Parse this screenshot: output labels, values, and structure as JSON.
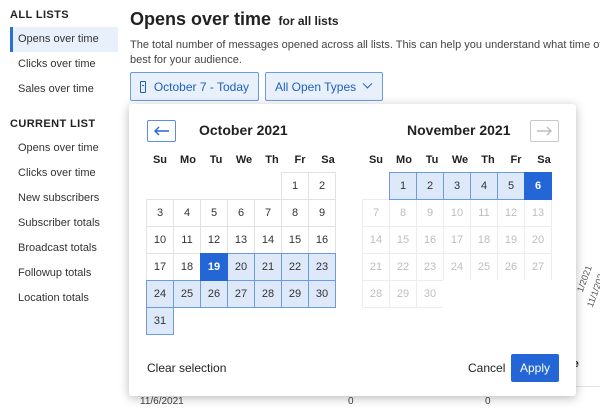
{
  "sidebar": {
    "all_lists_heading": "ALL LISTS",
    "all_lists_items": [
      {
        "label": "Opens over time"
      },
      {
        "label": "Clicks over time"
      },
      {
        "label": "Sales over time"
      }
    ],
    "current_list_heading": "CURRENT LIST",
    "current_list_items": [
      {
        "label": "Opens over time"
      },
      {
        "label": "Clicks over time"
      },
      {
        "label": "New subscribers"
      },
      {
        "label": "Subscriber totals"
      },
      {
        "label": "Broadcast totals"
      },
      {
        "label": "Followup totals"
      },
      {
        "label": "Location totals"
      }
    ]
  },
  "main": {
    "title": "Opens over time",
    "subtitle": "for all lists",
    "description_line1": "The total number of messages opened across all lists. This can help you understand what time of da",
    "description_line2": "best for your audience.",
    "date_filter_label": "October 7 - Today",
    "types_filter_label": "All Open Types"
  },
  "background_table": {
    "partial_header": "ue",
    "row_date": "11/6/2021",
    "row_value_1": "0",
    "row_value_2": "0",
    "axis_tick_1": "1/2021",
    "axis_tick_2": "11/1/202"
  },
  "datepicker": {
    "weekdays": [
      "Su",
      "Mo",
      "Tu",
      "We",
      "Th",
      "Fr",
      "Sa"
    ],
    "months": [
      {
        "title": "October 2021",
        "weeks": [
          [
            {
              "d": ""
            },
            {
              "d": ""
            },
            {
              "d": ""
            },
            {
              "d": ""
            },
            {
              "d": ""
            },
            {
              "d": "1"
            },
            {
              "d": "2"
            }
          ],
          [
            {
              "d": "3"
            },
            {
              "d": "4"
            },
            {
              "d": "5"
            },
            {
              "d": "6"
            },
            {
              "d": "7"
            },
            {
              "d": "8"
            },
            {
              "d": "9"
            }
          ],
          [
            {
              "d": "10"
            },
            {
              "d": "11"
            },
            {
              "d": "12"
            },
            {
              "d": "13"
            },
            {
              "d": "14"
            },
            {
              "d": "15"
            },
            {
              "d": "16"
            }
          ],
          [
            {
              "d": "17"
            },
            {
              "d": "18"
            },
            {
              "d": "19",
              "s": "selected"
            },
            {
              "d": "20",
              "s": "range"
            },
            {
              "d": "21",
              "s": "range"
            },
            {
              "d": "22",
              "s": "range"
            },
            {
              "d": "23",
              "s": "range"
            }
          ],
          [
            {
              "d": "24",
              "s": "range"
            },
            {
              "d": "25",
              "s": "range"
            },
            {
              "d": "26",
              "s": "range"
            },
            {
              "d": "27",
              "s": "range"
            },
            {
              "d": "28",
              "s": "range"
            },
            {
              "d": "29",
              "s": "range"
            },
            {
              "d": "30",
              "s": "range"
            }
          ],
          [
            {
              "d": "31",
              "s": "range"
            },
            {
              "d": ""
            },
            {
              "d": ""
            },
            {
              "d": ""
            },
            {
              "d": ""
            },
            {
              "d": ""
            },
            {
              "d": ""
            }
          ]
        ]
      },
      {
        "title": "November 2021",
        "weeks": [
          [
            {
              "d": ""
            },
            {
              "d": "1",
              "s": "range"
            },
            {
              "d": "2",
              "s": "range"
            },
            {
              "d": "3",
              "s": "range"
            },
            {
              "d": "4",
              "s": "range"
            },
            {
              "d": "5",
              "s": "range"
            },
            {
              "d": "6",
              "s": "selected"
            }
          ],
          [
            {
              "d": "7",
              "s": "disabled"
            },
            {
              "d": "8",
              "s": "disabled"
            },
            {
              "d": "9",
              "s": "disabled"
            },
            {
              "d": "10",
              "s": "disabled"
            },
            {
              "d": "11",
              "s": "disabled"
            },
            {
              "d": "12",
              "s": "disabled"
            },
            {
              "d": "13",
              "s": "disabled"
            }
          ],
          [
            {
              "d": "14",
              "s": "disabled"
            },
            {
              "d": "15",
              "s": "disabled"
            },
            {
              "d": "16",
              "s": "disabled"
            },
            {
              "d": "17",
              "s": "disabled"
            },
            {
              "d": "18",
              "s": "disabled"
            },
            {
              "d": "19",
              "s": "disabled"
            },
            {
              "d": "20",
              "s": "disabled"
            }
          ],
          [
            {
              "d": "21",
              "s": "disabled"
            },
            {
              "d": "22",
              "s": "disabled"
            },
            {
              "d": "23",
              "s": "disabled"
            },
            {
              "d": "24",
              "s": "disabled"
            },
            {
              "d": "25",
              "s": "disabled"
            },
            {
              "d": "26",
              "s": "disabled"
            },
            {
              "d": "27",
              "s": "disabled"
            }
          ],
          [
            {
              "d": "28",
              "s": "disabled"
            },
            {
              "d": "29",
              "s": "disabled"
            },
            {
              "d": "30",
              "s": "disabled"
            },
            {
              "d": ""
            },
            {
              "d": ""
            },
            {
              "d": ""
            },
            {
              "d": ""
            }
          ]
        ]
      }
    ],
    "clear_label": "Clear selection",
    "cancel_label": "Cancel",
    "apply_label": "Apply",
    "prev_icon": "arrow-left-icon",
    "next_icon": "arrow-right-icon"
  },
  "colors": {
    "accent": "#2466d6",
    "range_fill": "#dde8f8",
    "range_border": "#6b9be0"
  }
}
